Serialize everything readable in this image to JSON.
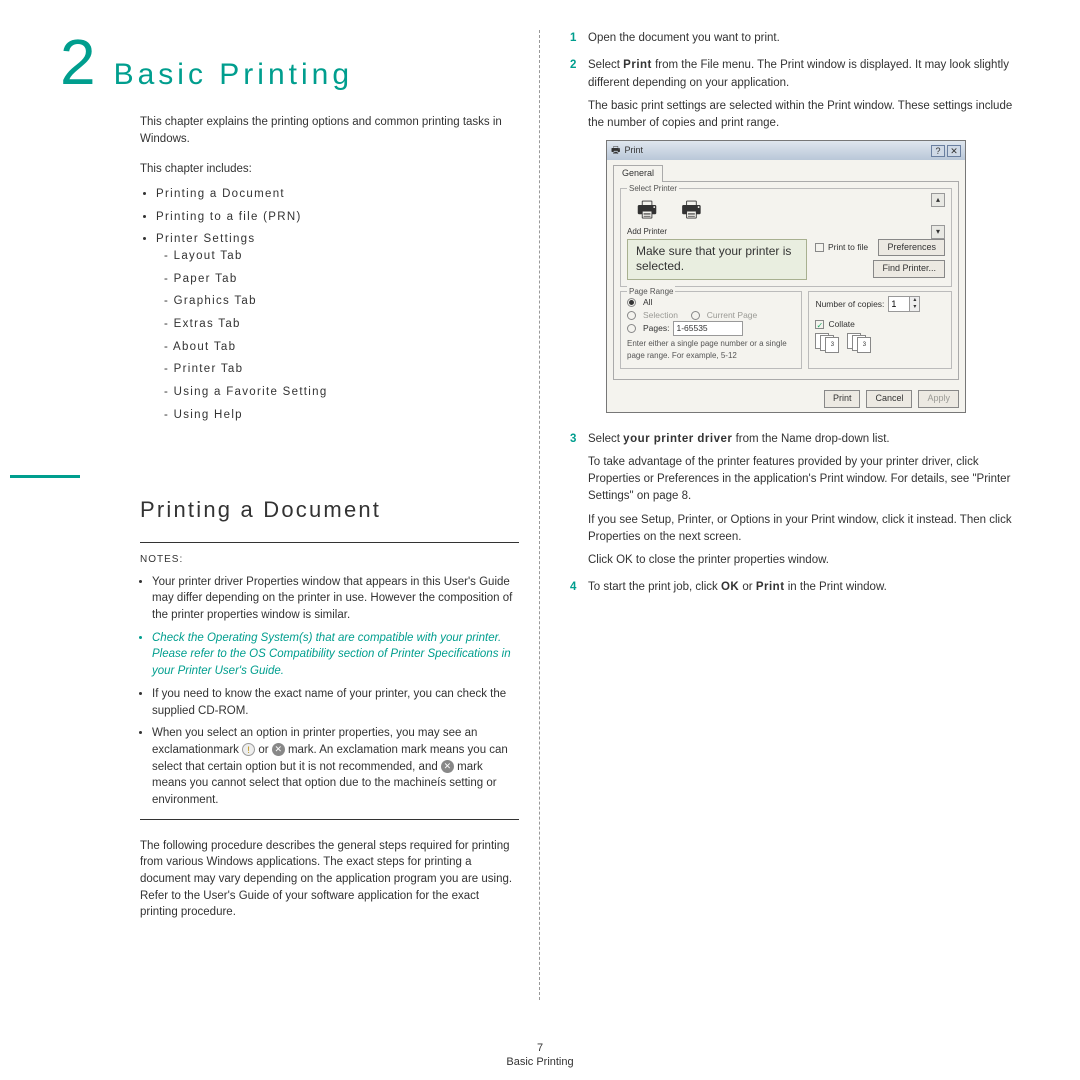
{
  "chapter": {
    "number": "2",
    "title": "Basic Printing"
  },
  "intro": "This chapter explains the printing options and common printing tasks in Windows.",
  "includes_label": "This chapter includes:",
  "toc": {
    "items": [
      "Printing a Document",
      "Printing to a file (PRN)",
      "Printer Settings"
    ],
    "sub": [
      "Layout Tab",
      "Paper Tab",
      "Graphics Tab",
      "Extras Tab",
      "About Tab",
      "Printer Tab",
      "Using a Favorite Setting",
      "Using Help"
    ]
  },
  "section_title": "Printing a Document",
  "notes_label": "NOTES:",
  "notes": {
    "n1": "Your printer driver Properties window that appears in this User's Guide may differ depending on the printer in use. However the composition of the printer properties window is similar.",
    "n2": "Check the Operating System(s) that are compatible with your printer. Please refer to the OS Compatibility section of Printer Specifications in your Printer User's Guide.",
    "n3": "If you need to know the exact name of your printer, you can check the supplied CD-ROM.",
    "n4a": "When you select an option in printer properties, you may see an exclamationmark ",
    "n4b": " or ",
    "n4c": " mark. An exclamation mark means you can select that certain option but it is not recommended, and ",
    "n4d": " mark means you cannot select that option due to the machineís setting or environment."
  },
  "procedure_intro": "The following procedure describes the general steps required for printing from various Windows applications. The exact steps for printing a document may vary depending on the application program you are using. Refer to the User's Guide of your software application for the exact printing procedure.",
  "steps": {
    "s1": "Open the document you want to print.",
    "s2a": "Select ",
    "s2b": "Print",
    "s2c": " from the File menu. The Print window is displayed. It may look slightly different depending on your application.",
    "s2d": "The basic print settings are selected within the Print window. These settings include the number of copies and print range.",
    "s3a": "Select ",
    "s3b": "your printer driver",
    "s3c": " from the Name drop-down list.",
    "s3d": "To take advantage of the printer features provided by your printer driver, click Properties or Preferences in the application's Print window. For details, see \"Printer Settings\" on page 8.",
    "s3e": "If you see Setup, Printer, or Options in your Print window, click it instead. Then click Properties on the next screen.",
    "s3f": "Click OK to close the printer properties window.",
    "s4a": "To start the print job, click ",
    "s4b": "OK",
    "s4c": " or ",
    "s4d": "Print",
    "s4e": " in the Print window."
  },
  "dialog": {
    "title": "Print",
    "tab": "General",
    "group_select": "Select Printer",
    "add_printer": "Add Printer",
    "callout": "Make sure that your printer is selected.",
    "print_to_file": "Print to file",
    "preferences": "Preferences",
    "find_printer": "Find Printer...",
    "group_range": "Page Range",
    "all": "All",
    "selection": "Selection",
    "current_page": "Current Page",
    "pages": "Pages:",
    "pages_value": "1-65535",
    "range_hint": "Enter either a single page number or a single page range. For example, 5-12",
    "copies_label": "Number of copies:",
    "copies_value": "1",
    "collate": "Collate",
    "btn_print": "Print",
    "btn_cancel": "Cancel",
    "btn_apply": "Apply"
  },
  "footer": {
    "page": "7",
    "title": "Basic Printing"
  }
}
